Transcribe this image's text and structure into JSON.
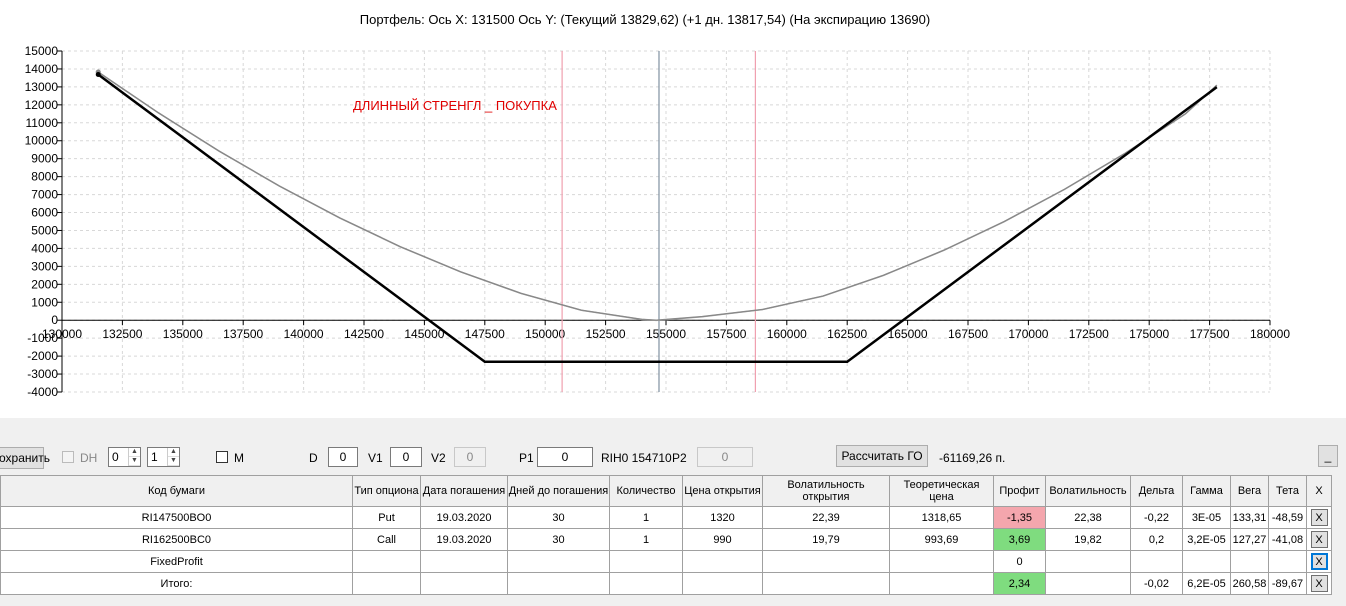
{
  "chart": {
    "title": "Портфель: Ось X: 131500 Ось Y:  (Текущий 13829,62)  (+1 дн. 13817,54)  (На экспирацию 13690)",
    "strategy_label": "ДЛИННЫЙ СТРЕНГЛ _ ПОКУПКА"
  },
  "chart_data": {
    "type": "line",
    "xlim": [
      130000,
      180000
    ],
    "ylim": [
      -4000,
      15000
    ],
    "x_ticks": [
      130000,
      132500,
      135000,
      137500,
      140000,
      142500,
      145000,
      147500,
      150000,
      152500,
      155000,
      157500,
      160000,
      162500,
      165000,
      167500,
      170000,
      172500,
      175000,
      177500,
      180000
    ],
    "y_ticks": [
      15000,
      14000,
      13000,
      12000,
      11000,
      10000,
      9000,
      8000,
      7000,
      6000,
      5000,
      4000,
      3000,
      2000,
      1000,
      0,
      -1000,
      -2000,
      -3000,
      -4000
    ],
    "grid": true,
    "vertical_markers": [
      {
        "x": 154710,
        "color": "#8090a0"
      },
      {
        "x": 150700,
        "color": "#f0a0b0"
      },
      {
        "x": 158700,
        "color": "#f0a0b0"
      }
    ],
    "series": [
      {
        "style": "expiration",
        "color": "#000000",
        "x": [
          131500,
          147500,
          162500,
          177800
        ],
        "y": [
          13690,
          -2310,
          -2310,
          12990
        ]
      },
      {
        "style": "current",
        "color": "#888888",
        "x": [
          131500,
          134000,
          136500,
          139000,
          141500,
          144000,
          146500,
          149000,
          151500,
          154000,
          154600,
          156500,
          159000,
          161500,
          164000,
          166500,
          169000,
          171500,
          174000,
          176500,
          177800
        ],
        "y": [
          13830,
          11550,
          9430,
          7480,
          5700,
          4100,
          2700,
          1500,
          560,
          50,
          0,
          200,
          600,
          1350,
          2500,
          3900,
          5500,
          7300,
          9300,
          11500,
          13100
        ]
      },
      {
        "style": "plus1day",
        "color": "#b0b0b0",
        "x": [
          131500,
          134000,
          136500,
          139000,
          141500,
          144000,
          146500,
          149000,
          151500,
          154000,
          154600,
          156500,
          159000,
          161500,
          164000,
          166500,
          169000,
          171500,
          174000,
          176500,
          177800
        ],
        "y": [
          13818,
          11540,
          9420,
          7470,
          5690,
          4090,
          2690,
          1490,
          550,
          40,
          -10,
          190,
          590,
          1340,
          2490,
          3890,
          5490,
          7290,
          9290,
          11490,
          13090
        ]
      }
    ]
  },
  "controls": {
    "save_label": "охранить",
    "dh_label": "DH",
    "spin1_value": "0",
    "spin2_value": "1",
    "m_label": "M",
    "d_label": "D",
    "d_value": "0",
    "v1_label": "V1",
    "v1_value": "0",
    "v2_label": "V2",
    "v2_value": "0",
    "p1_label": "P1",
    "p1_value": "0",
    "instrument_text": "RIH0 154710",
    "p2_label": "P2",
    "p2_value": "0",
    "calc_button": "Рассчитать ГО",
    "go_value": "-61169,26 п.",
    "minimize_label": "_"
  },
  "table": {
    "headers": [
      "Код бумаги",
      "Тип опциона",
      "Дата погашения",
      "Дней до погашения",
      "Количество",
      "Цена открытия",
      "Волатильность открытия",
      "Теоретическая цена",
      "Профит",
      "Волатильность",
      "Дельта",
      "Гамма",
      "Вега",
      "Тета",
      "X"
    ],
    "rows": [
      {
        "code": "RI147500BO0",
        "type": "Put",
        "date": "19.03.2020",
        "days": "30",
        "qty": "1",
        "price": "1320",
        "vol_open": "22,39",
        "theor": "1318,65",
        "profit": "-1,35",
        "vol": "22,38",
        "delta": "-0,22",
        "gamma": "3E-05",
        "vega": "133,31",
        "theta": "-48,59",
        "x": "X"
      },
      {
        "code": "RI162500BC0",
        "type": "Call",
        "date": "19.03.2020",
        "days": "30",
        "qty": "1",
        "price": "990",
        "vol_open": "19,79",
        "theor": "993,69",
        "profit": "3,69",
        "vol": "19,82",
        "delta": "0,2",
        "gamma": "3,2E-05",
        "vega": "127,27",
        "theta": "-41,08",
        "x": "X"
      },
      {
        "code": "FixedProfit",
        "type": "",
        "date": "",
        "days": "",
        "qty": "",
        "price": "",
        "vol_open": "",
        "theor": "",
        "profit": "0",
        "vol": "",
        "delta": "",
        "gamma": "",
        "vega": "",
        "theta": "",
        "x": "X"
      },
      {
        "code": "Итого:",
        "type": "",
        "date": "",
        "days": "",
        "qty": "",
        "price": "",
        "vol_open": "",
        "theor": "",
        "profit": "2,34",
        "vol": "",
        "delta": "-0,02",
        "gamma": "6,2E-05",
        "vega": "260,58",
        "theta": "-89,67",
        "x": "X"
      }
    ]
  }
}
